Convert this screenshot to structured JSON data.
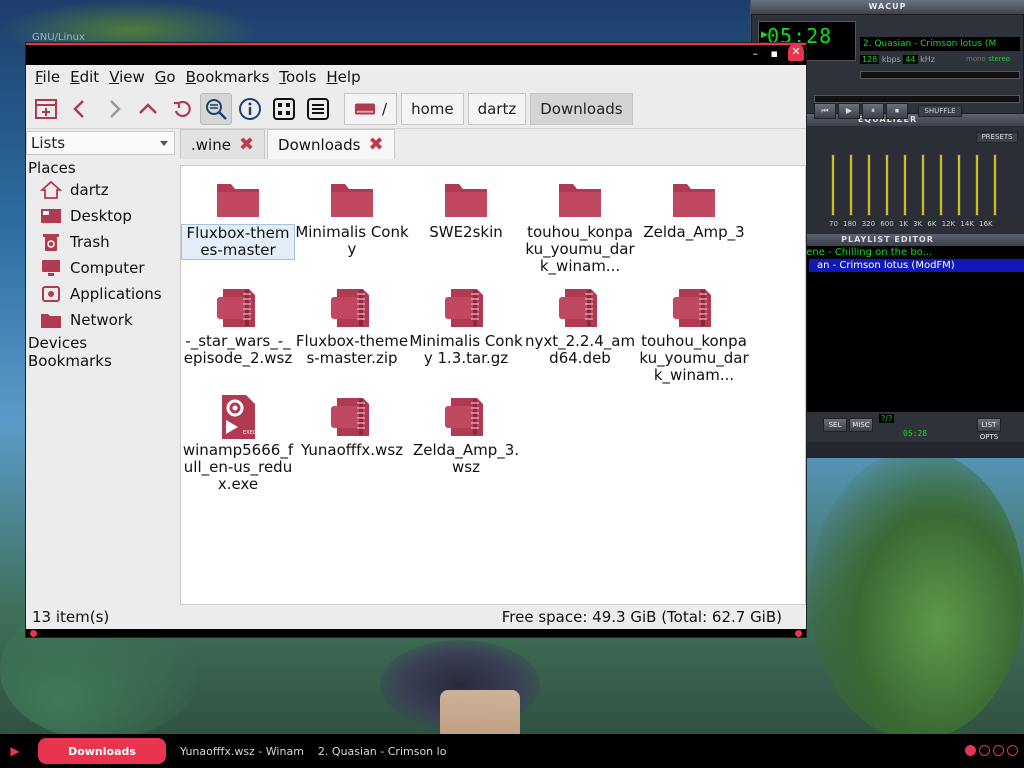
{
  "desktop": {
    "os_label": "GNU/Linux"
  },
  "winamp": {
    "title": "WACUP",
    "time": "05:28",
    "song": "2. Quasian - Crimson lotus (M",
    "kbps": "128",
    "kbps_unit": "kbps",
    "khz": "44",
    "khz_unit": "kHz",
    "mono": "mono",
    "stereo": "stereo",
    "shuffle": "SHUFFLE",
    "eq_title": "EQUALIZER",
    "eq_on": "ON",
    "eq_auto": "AUTO",
    "presets": "PRESETS",
    "eq_bands": "70 180 320 600 1K 3K 6K 12K 14K 16K",
    "playlist_title": "PLAYLIST EDITOR",
    "playlist": [
      "- Demoscene - Chilling on the bo...",
      "an - Crimson lotus (ModFM)"
    ],
    "pl_sel": "SEL",
    "pl_misc": "MISC",
    "pl_list": "LIST OPTS",
    "pl_q": "?/?",
    "pl_time": "05:28"
  },
  "window": {
    "menu": [
      "File",
      "Edit",
      "View",
      "Go",
      "Bookmarks",
      "Tools",
      "Help"
    ],
    "path": [
      "/",
      "home",
      "dartz",
      "Downloads"
    ],
    "sidebar": {
      "mode": "Lists",
      "places_heading": "Places",
      "places": [
        "dartz",
        "Desktop",
        "Trash",
        "Computer",
        "Applications",
        "Network"
      ],
      "devices_heading": "Devices",
      "bookmarks_heading": "Bookmarks"
    },
    "tabs": [
      ".wine",
      "Downloads"
    ],
    "files": [
      {
        "name": "Fluxbox-themes-master",
        "kind": "folder"
      },
      {
        "name": "Minimalis Conky",
        "kind": "folder"
      },
      {
        "name": "SWE2skin",
        "kind": "folder"
      },
      {
        "name": "touhou_konpaku_youmu_dark_winam...",
        "kind": "folder"
      },
      {
        "name": "Zelda_Amp_3",
        "kind": "folder"
      },
      {
        "name": "-_star_wars_-_episode_2.wsz",
        "kind": "archive"
      },
      {
        "name": "Fluxbox-themes-master.zip",
        "kind": "archive"
      },
      {
        "name": "Minimalis Conky 1.3.tar.gz",
        "kind": "archive"
      },
      {
        "name": "nyxt_2.2.4_amd64.deb",
        "kind": "archive"
      },
      {
        "name": "touhou_konpaku_youmu_dark_winam...",
        "kind": "archive"
      },
      {
        "name": "winamp5666_full_en-us_redux.exe",
        "kind": "exe"
      },
      {
        "name": "Yunaofffx.wsz",
        "kind": "archive"
      },
      {
        "name": "Zelda_Amp_3.wsz",
        "kind": "archive"
      }
    ],
    "status_left": "13 item(s)",
    "status_right": "Free space: 49.3 GiB (Total: 62.7 GiB)"
  },
  "taskbar": {
    "active": "Downloads",
    "tasks": [
      "Yunaofffx.wsz - Winam",
      "2. Quasian - Crimson lo"
    ]
  },
  "colors": {
    "accent": "#e8344e",
    "folder": "#b03a52",
    "winamp_green": "#0fdc1a"
  }
}
